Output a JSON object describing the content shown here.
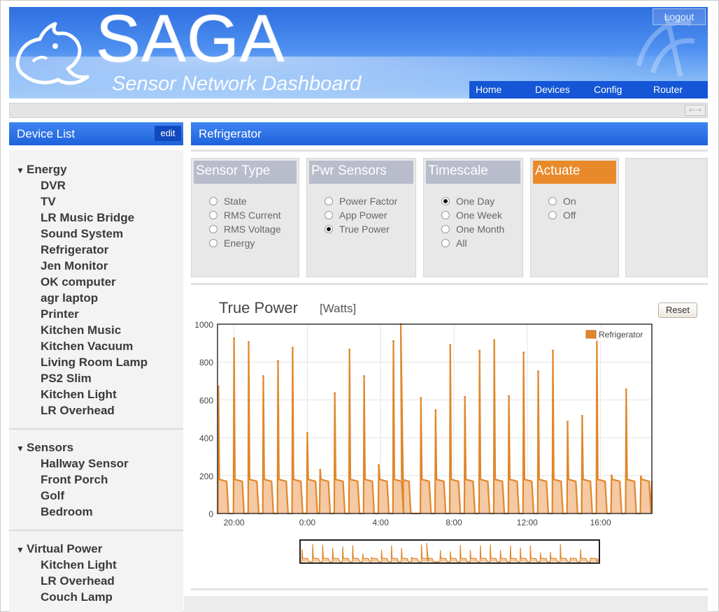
{
  "header": {
    "title": "SAGA",
    "subtitle": "Sensor Network Dashboard",
    "logout_label": "Logout",
    "nav": [
      {
        "label": "Home"
      },
      {
        "label": "Devices"
      },
      {
        "label": "Config"
      },
      {
        "label": "Router"
      }
    ]
  },
  "subbar": {
    "expand_icon": "expand-arrows-icon"
  },
  "sidebar": {
    "title": "Device List",
    "edit_label": "edit",
    "groups": [
      {
        "name": "Energy",
        "devices": [
          "DVR",
          "TV",
          "LR Music Bridge",
          "Sound System",
          "Refrigerator",
          "Jen Monitor",
          "OK computer",
          "agr laptop",
          "Printer",
          "Kitchen Music",
          "Kitchen Vacuum",
          "Living Room Lamp",
          "PS2 Slim",
          "Kitchen Light",
          "LR Overhead"
        ]
      },
      {
        "name": "Sensors",
        "devices": [
          "Hallway Sensor",
          "Front Porch",
          "Golf",
          "Bedroom"
        ]
      },
      {
        "name": "Virtual Power",
        "devices": [
          "Kitchen Light",
          "LR Overhead",
          "Couch Lamp"
        ]
      }
    ]
  },
  "main": {
    "title": "Refrigerator",
    "panels": [
      {
        "title": "Sensor Type",
        "options": [
          {
            "label": "State",
            "checked": false
          },
          {
            "label": "RMS Current",
            "checked": false
          },
          {
            "label": "RMS Voltage",
            "checked": false
          },
          {
            "label": "Energy",
            "checked": false
          }
        ]
      },
      {
        "title": "Pwr Sensors",
        "options": [
          {
            "label": "Power Factor",
            "checked": false
          },
          {
            "label": "App Power",
            "checked": false
          },
          {
            "label": "True Power",
            "checked": true
          }
        ]
      },
      {
        "title": "Timescale",
        "options": [
          {
            "label": "One Day",
            "checked": true
          },
          {
            "label": "One Week",
            "checked": false
          },
          {
            "label": "One Month",
            "checked": false
          },
          {
            "label": "All",
            "checked": false
          }
        ]
      },
      {
        "title": "Actuate",
        "options": [
          {
            "label": "On",
            "checked": false
          },
          {
            "label": "Off",
            "checked": false
          }
        ]
      }
    ],
    "reset_label": "Reset"
  },
  "colors": {
    "header_blue": "#2f6fe0",
    "nav_blue": "#1456d6",
    "panel_title_gray": "#b8bccb",
    "actuate_orange": "#e88a2a",
    "series_orange": "#e0872b",
    "series_fill": "#f4c9a3"
  },
  "chart_data": {
    "type": "area",
    "title": "True Power",
    "unit": "[Watts]",
    "ylim": [
      0,
      1000
    ],
    "yticks": [
      0,
      200,
      400,
      600,
      800,
      1000
    ],
    "xticks": [
      "20:00",
      "0:00",
      "4:00",
      "8:00",
      "12:00",
      "16:00"
    ],
    "xtick_hours": [
      20,
      24,
      28,
      32,
      36,
      40
    ],
    "xlim_hours": [
      19.1,
      42.8
    ],
    "legend": "top-right",
    "series": [
      {
        "name": "Refrigerator",
        "peaks": [
          {
            "h": 19.15,
            "v": 670
          },
          {
            "h": 20.0,
            "v": 925
          },
          {
            "h": 20.8,
            "v": 905
          },
          {
            "h": 21.6,
            "v": 725
          },
          {
            "h": 22.4,
            "v": 805
          },
          {
            "h": 23.2,
            "v": 875
          },
          {
            "h": 24.0,
            "v": 425
          },
          {
            "h": 24.7,
            "v": 230
          },
          {
            "h": 25.5,
            "v": 635
          },
          {
            "h": 26.3,
            "v": 865
          },
          {
            "h": 27.1,
            "v": 725
          },
          {
            "h": 27.9,
            "v": 255
          },
          {
            "h": 28.7,
            "v": 910
          },
          {
            "h": 29.1,
            "v": 1000
          },
          {
            "h": 30.2,
            "v": 610
          },
          {
            "h": 31.0,
            "v": 545
          },
          {
            "h": 31.8,
            "v": 890
          },
          {
            "h": 32.6,
            "v": 615
          },
          {
            "h": 33.4,
            "v": 860
          },
          {
            "h": 34.2,
            "v": 915
          },
          {
            "h": 35.0,
            "v": 620
          },
          {
            "h": 35.8,
            "v": 850
          },
          {
            "h": 36.6,
            "v": 750
          },
          {
            "h": 37.4,
            "v": 860
          },
          {
            "h": 38.2,
            "v": 485
          },
          {
            "h": 39.0,
            "v": 515
          },
          {
            "h": 39.8,
            "v": 920
          },
          {
            "h": 40.6,
            "v": 200
          },
          {
            "h": 41.4,
            "v": 655
          },
          {
            "h": 42.2,
            "v": 195
          }
        ],
        "baseline": 170
      }
    ]
  }
}
